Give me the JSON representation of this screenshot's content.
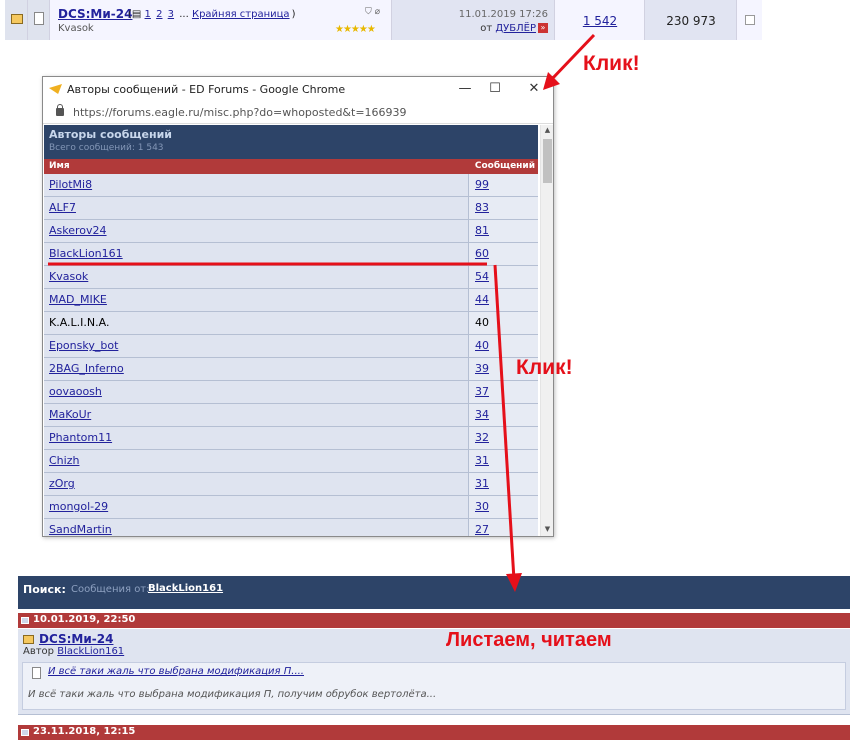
{
  "thread_row": {
    "title": "DCS:Ми-24",
    "page_links": [
      "1",
      "2",
      "3"
    ],
    "page_ellipsis": "...",
    "last_page_label": "Крайняя страница",
    "author": "Kvasok",
    "last_post_date": "11.01.2019 17:26",
    "last_post_by_prefix": "от",
    "last_post_by": "ДУБЛЁР",
    "replies": "1 542",
    "views": "230 973",
    "rating": "★★★★★"
  },
  "popup": {
    "window_title": "Авторы сообщений - ED Forums - Google Chrome",
    "url": "https://forums.eagle.ru/misc.php?do=whoposted&t=166939",
    "panel_title": "Авторы сообщений",
    "panel_subtitle": "Всего сообщений: 1 543",
    "col_name": "Имя",
    "col_count": "Сообщений",
    "minimize_glyph": "—",
    "maximize_glyph": "☐",
    "close_glyph": "✕",
    "scroll_up_glyph": "▲",
    "scroll_down_glyph": "▼",
    "posters": [
      {
        "name": "PilotMi8",
        "count": "99"
      },
      {
        "name": "ALF7",
        "count": "83"
      },
      {
        "name": "Askerov24",
        "count": "81"
      },
      {
        "name": "BlackLion161",
        "count": "60"
      },
      {
        "name": "Kvasok",
        "count": "54"
      },
      {
        "name": "MAD_MIKE",
        "count": "44"
      },
      {
        "name": "K.A.L.I.N.A.",
        "count": "40"
      },
      {
        "name": "Eponsky_bot",
        "count": "40"
      },
      {
        "name": "2BAG_Inferno",
        "count": "39"
      },
      {
        "name": "oovaoosh",
        "count": "37"
      },
      {
        "name": "MaKoUr",
        "count": "34"
      },
      {
        "name": "Phantom11",
        "count": "32"
      },
      {
        "name": "Chizh",
        "count": "31"
      },
      {
        "name": "zOrg",
        "count": "31"
      },
      {
        "name": "mongol-29",
        "count": "30"
      },
      {
        "name": "SandMartin",
        "count": "27"
      }
    ]
  },
  "search": {
    "label": "Поиск:",
    "by_prefix": "Сообщения от:",
    "user": "BlackLion161",
    "post1_date": "10.01.2019, 22:50",
    "post1_title": "DCS:Ми-24",
    "post1_author_prefix": "Автор",
    "post1_author": "BlackLion161",
    "post1_quote_link": "И всё таки жаль что выбрана модификация П....",
    "post1_quote_text": "И всё таки жаль что выбрана модификация П, получим обрубок вертолёта...",
    "post2_date": "23.11.2018, 12:15"
  },
  "annotations": {
    "click_top": "Клик!",
    "click_middle": "Клик!",
    "scroll_read": "Листаем, читаем",
    "color": "#e5101a"
  },
  "colors": {
    "panel_blue": "#2d4468",
    "header_red": "#b13a3a",
    "row_bg": "#dfe4f0",
    "link": "#22229c"
  }
}
